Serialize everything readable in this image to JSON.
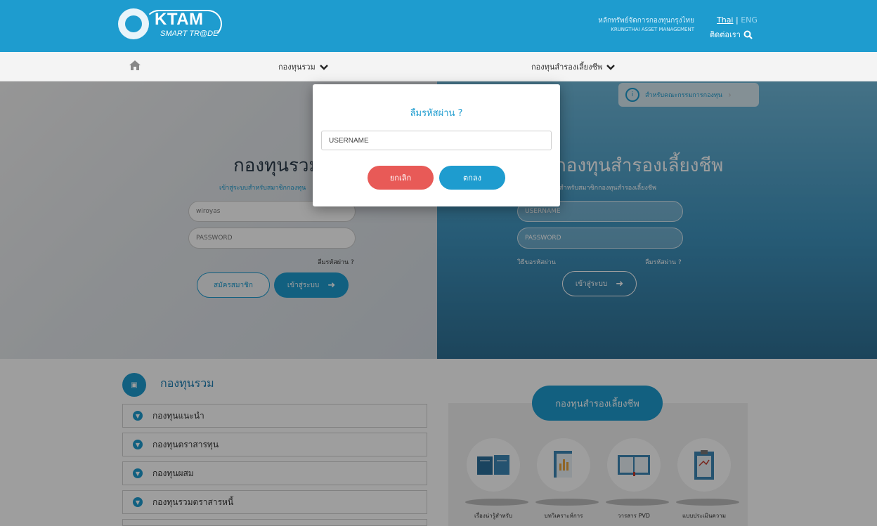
{
  "header": {
    "logo_title": "KTAM",
    "logo_subtitle": "SMART TR@DE",
    "org_th": "หลักทรัพย์จัดการกองทุนกรุงไทย",
    "org_en": "KRUNGTHAI ASSET MANAGEMENT",
    "lang_th": "Thai",
    "lang_sep": "|",
    "lang_en": "ENG",
    "contact": "ติดต่อเรา"
  },
  "nav": {
    "home_icon": "home-icon",
    "items": [
      {
        "label": "กองทุนรวม"
      },
      {
        "label": "กองทุนสำรองเลี้ยงชีพ"
      }
    ]
  },
  "hero": {
    "committee_label": "สำหรับคณะกรรมการกองทุน",
    "left": {
      "title": "กองทุนรวม",
      "subtitle": "เข้าสู่ระบบสำหรับสมาชิกกองทุน",
      "username_value": "wiroyas",
      "password_placeholder": "PASSWORD",
      "forgot": "ลืมรหัสผ่าน ?",
      "register": "สมัครสมาชิก",
      "login": "เข้าสู่ระบบ"
    },
    "right": {
      "title": "กองทุนสำรองเลี้ยงชีพ",
      "subtitle": "สำหรับสมาชิกกองทุนสำรองเลี้ยงชีพ",
      "username_placeholder": "USERNAME",
      "password_placeholder": "PASSWORD",
      "howto": "วิธีขอรหัสผ่าน",
      "forgot": "ลืมรหัสผ่าน ?",
      "login": "เข้าสู่ระบบ"
    }
  },
  "lower": {
    "section_title": "กองทุนรวม",
    "fund_items": [
      "กองทุนแนะนำ",
      "กองทุนตราสารทุน",
      "กองทุนผสม",
      "กองทุนรวมตราสารหนี้"
    ],
    "pvd_title": "กองทุนสำรองเลี้ยงชีพ",
    "docs": [
      {
        "caption": "เรื่องน่ารู้สำหรับ",
        "icon": "books-icon"
      },
      {
        "caption": "บทวิเคราะห์การ",
        "icon": "chart-document-icon"
      },
      {
        "caption": "วารสาร PVD",
        "icon": "magazine-icon"
      },
      {
        "caption": "แบบประเมินความ",
        "icon": "clipboard-icon"
      }
    ]
  },
  "modal": {
    "title": "ลืมรหัสผ่าน ?",
    "username_value": "USERNAME",
    "cancel": "ยกเลิก",
    "ok": "ตกลง"
  },
  "colors": {
    "brand_blue": "#1e9ccf",
    "cancel_red": "#e85a57"
  }
}
